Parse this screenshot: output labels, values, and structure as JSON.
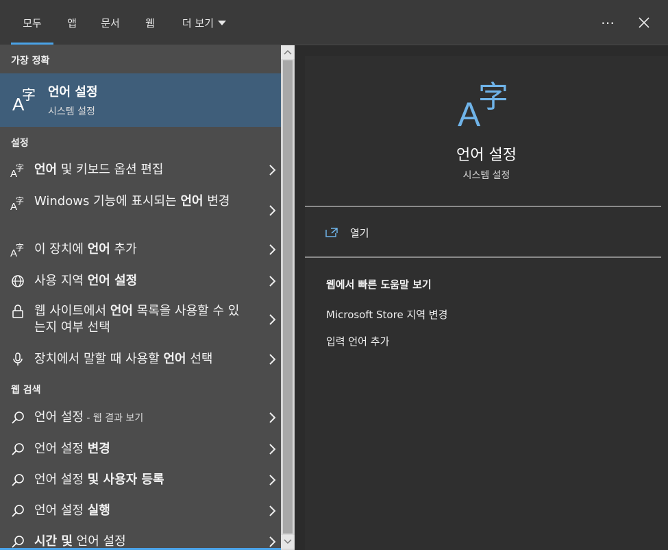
{
  "tabs": [
    {
      "label": "모두",
      "active": true
    },
    {
      "label": "앱"
    },
    {
      "label": "문서"
    },
    {
      "label": "웹"
    },
    {
      "label": "더 보기"
    }
  ],
  "top_icons": {
    "more": "⋯",
    "close": "close-icon"
  },
  "left": {
    "best_match_header": "가장 정확",
    "best_match": {
      "title": "언어 설정",
      "subtitle": "시스템 설정",
      "icon": "language-icon"
    },
    "settings_header": "설정",
    "settings_items": [
      {
        "pre": "",
        "bold": "언어",
        "post": " 및 키보드 옵션 편집",
        "icon": "language-icon"
      },
      {
        "pre": "Windows 기능에 표시되는 ",
        "bold": "언어",
        "post": " 변경",
        "icon": "language-icon"
      },
      {
        "pre": "이 장치에 ",
        "bold": "언어",
        "post": " 추가",
        "icon": "language-icon"
      },
      {
        "pre": "사용 지역 ",
        "bold": "언어 설정",
        "post": "",
        "icon": "globe-icon"
      },
      {
        "pre": "웹 사이트에서 ",
        "bold": "언어",
        "post": " 목록을 사용할 수 있는지 여부 선택",
        "icon": "lock-icon"
      },
      {
        "pre": "장치에서 말할 때 사용할 ",
        "bold": "언어",
        "post": " 선택",
        "icon": "microphone-icon"
      }
    ],
    "web_header": "웹 검색",
    "web_items": [
      {
        "pre": "언어 설정",
        "bold": "",
        "post": "",
        "small": " - 웹 결과 보기",
        "icon": "search-icon"
      },
      {
        "pre": "언어 설정 ",
        "bold": "변경",
        "post": "",
        "icon": "search-icon"
      },
      {
        "pre": "언어 설정 ",
        "bold": "및 사용자 등록",
        "post": "",
        "icon": "search-icon"
      },
      {
        "pre": "언어 설정 ",
        "bold": "실행",
        "post": "",
        "icon": "search-icon"
      },
      {
        "pre": "",
        "bold": "시간 및",
        "post": " 언어 설정",
        "icon": "search-icon"
      }
    ]
  },
  "right": {
    "title": "언어 설정",
    "subtitle": "시스템 설정",
    "open_label": "열기",
    "help_header": "웹에서 빠른 도움말 보기",
    "help_links": [
      "Microsoft Store 지역 변경",
      "입력 언어 추가"
    ]
  },
  "colors": {
    "accent": "#4aa3e8",
    "selected": "#3f5e7a",
    "glyph": "#6fb3e8"
  }
}
